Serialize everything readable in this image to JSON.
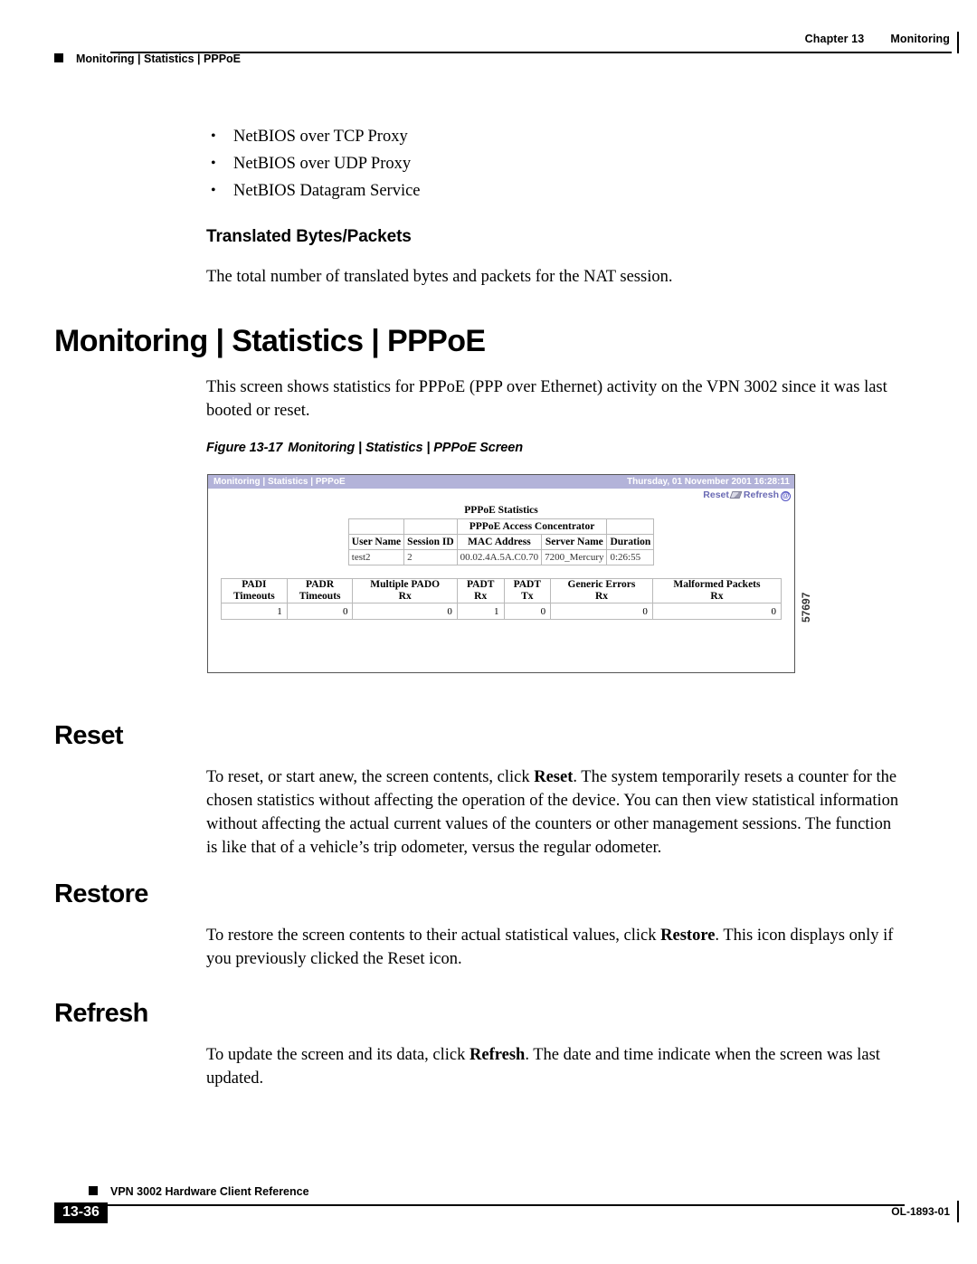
{
  "header": {
    "chapter": "Chapter 13",
    "chapter_title": "Monitoring",
    "breadcrumb": "Monitoring | Statistics | PPPoE"
  },
  "bullets": [
    "NetBIOS over TCP Proxy",
    "NetBIOS over UDP Proxy",
    "NetBIOS Datagram Service"
  ],
  "subsection": {
    "heading": "Translated Bytes/Packets",
    "body": "The total number of translated bytes and packets for the NAT session."
  },
  "section": {
    "title": "Monitoring | Statistics | PPPoE",
    "intro": "This screen shows statistics for PPPoE (PPP over Ethernet) activity on the VPN 3002 since it was last booted or reset."
  },
  "figure": {
    "caption_label": "Figure 13-17",
    "caption_text": "Monitoring | Statistics | PPPoE Screen",
    "figure_id": "57697",
    "titlebar": {
      "breadcrumb": "Monitoring | Statistics | PPPoE",
      "timestamp": "Thursday, 01 November 2001 16:28:11"
    },
    "actions": {
      "reset": "Reset",
      "refresh": "Refresh"
    },
    "stats_title": "PPPoE Statistics",
    "session_table": {
      "group_header": "PPPoE Access Concentrator",
      "columns": [
        "User Name",
        "Session ID",
        "MAC Address",
        "Server Name",
        "Duration"
      ],
      "rows": [
        [
          "test2",
          "2",
          "00.02.4A.5A.C0.70",
          "7200_Mercury",
          "0:26:55"
        ]
      ]
    },
    "counter_table": {
      "columns": [
        {
          "line1": "PADI",
          "line2": "Timeouts"
        },
        {
          "line1": "PADR",
          "line2": "Timeouts"
        },
        {
          "line1": "Multiple PADO",
          "line2": "Rx"
        },
        {
          "line1": "PADT",
          "line2": "Rx"
        },
        {
          "line1": "PADT",
          "line2": "Tx"
        },
        {
          "line1": "Generic Errors",
          "line2": "Rx"
        },
        {
          "line1": "Malformed Packets",
          "line2": "Rx"
        }
      ],
      "values": [
        "1",
        "0",
        "0",
        "1",
        "0",
        "0",
        "0"
      ]
    },
    "colors": {
      "titlebar_bg": "#b3b3d9",
      "link": "#6a6ab4"
    }
  },
  "reset": {
    "heading": "Reset",
    "body_pre": "To reset, or start anew, the screen contents, click ",
    "body_bold": "Reset",
    "body_post": ". The system temporarily resets a counter for the chosen statistics without affecting the operation of the device. You can then view statistical information without affecting the actual current values of the counters or other management sessions. The function is like that of a vehicle’s trip odometer, versus the regular odometer."
  },
  "restore": {
    "heading": "Restore",
    "body_pre": "To restore the screen contents to their actual statistical values, click ",
    "body_bold": "Restore",
    "body_post": ". This icon displays only if you previously clicked the Reset icon."
  },
  "refresh": {
    "heading": "Refresh",
    "body_pre": "To update the screen and its data, click ",
    "body_bold": "Refresh",
    "body_post": ". The date and time indicate when the screen was last updated."
  },
  "footer": {
    "book_title": "VPN 3002 Hardware Client Reference",
    "page_number": "13-36",
    "doc_number": "OL-1893-01"
  }
}
